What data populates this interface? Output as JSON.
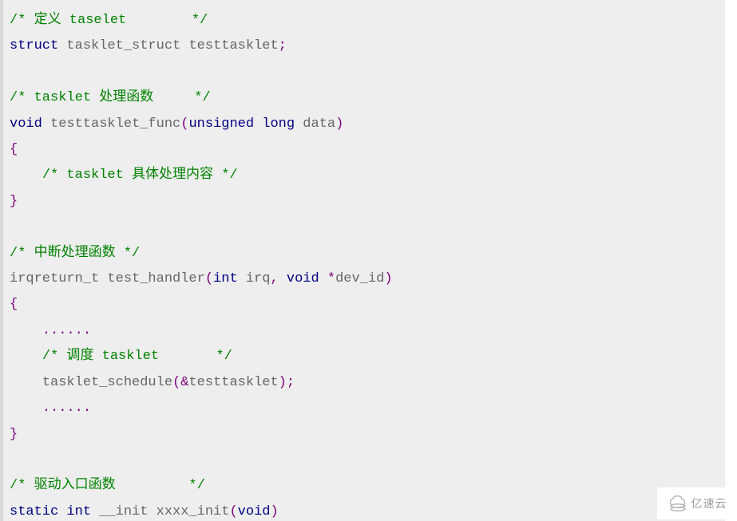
{
  "code": {
    "c1_a": "/* 定义 taselet",
    "c1_b": "        */",
    "kw1": "struct",
    "t1a": " tasklet_struct testtasklet",
    "p1": ";",
    "c2_a": "/* tasklet 处理函数",
    "c2_b": "     */",
    "kw2": "void",
    "t2a": " testtasklet_func",
    "p2a": "(",
    "kw2b": "unsigned",
    "sp2": " ",
    "kw2c": "long",
    "t2b": " data",
    "p2b": ")",
    "p3": "{",
    "t3_indent": "    ",
    "c3": "/* tasklet 具体处理内容 */",
    "p4": "}",
    "c5": "/* 中断处理函数 */",
    "t6a": "irqreturn_t test_handler",
    "p6a": "(",
    "kw6a": "int",
    "t6b": " irq",
    "p6b": ",",
    "sp6": " ",
    "kw6b": "void",
    "sp6b": " ",
    "p6c": "*",
    "t6c": "dev_id",
    "p6d": ")",
    "p7": "{",
    "t8_indent": "    ",
    "p8dots": "......",
    "t9_indent": "    ",
    "c9_a": "/* 调度 tasklet",
    "c9_b": "       */",
    "t10_indent": "    ",
    "t10a": "tasklet_schedule",
    "p10a": "(",
    "p10b": "&",
    "t10b": "testtasklet",
    "p10c": ")",
    "p10d": ";",
    "t11_indent": "    ",
    "p11dots": "......",
    "p12": "}",
    "c13_a": "/* 驱动入口函数",
    "c13_b": "         */",
    "kw14a": "static",
    "sp14a": " ",
    "kw14b": "int",
    "t14a": " __init xxxx_init",
    "p14a": "(",
    "kw14c": "void",
    "p14b": ")"
  },
  "watermark": {
    "text": "亿速云",
    "icon": "cloud-stack-icon"
  }
}
